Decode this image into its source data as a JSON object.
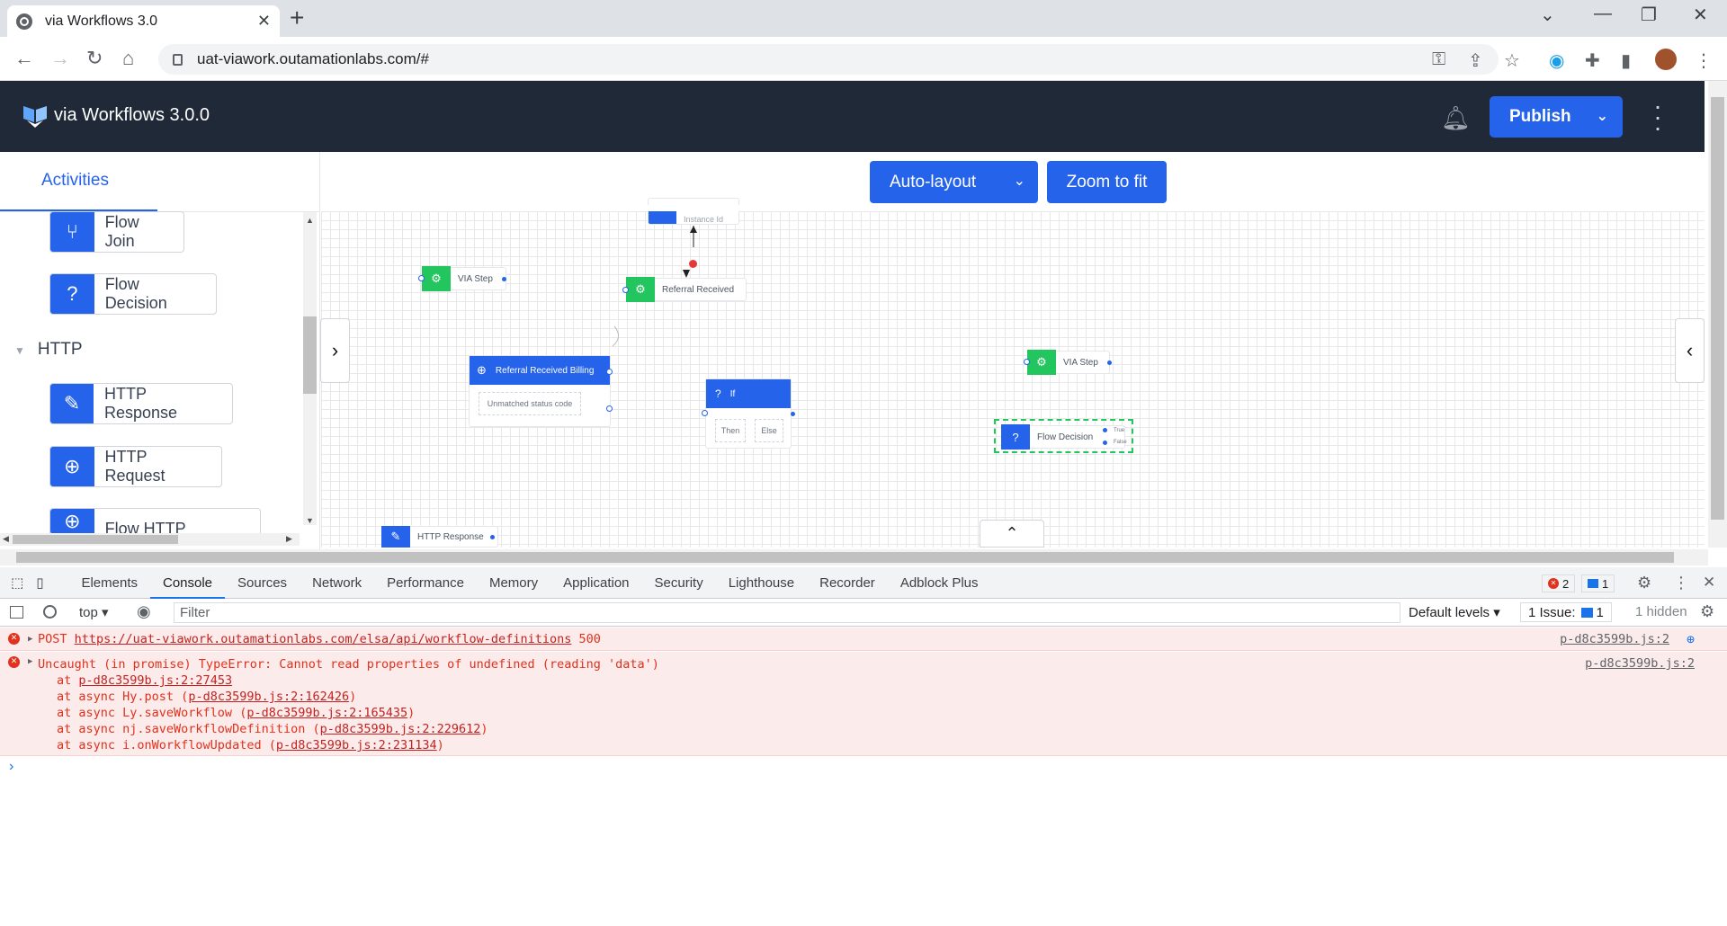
{
  "browser": {
    "tab_title": "via Workflows 3.0",
    "tab_close": "✕",
    "new_tab": "+",
    "url": "uat-viawork.outamationlabs.com/#"
  },
  "app": {
    "title": "via Workflows 3.0.0",
    "publish_label": "Publish"
  },
  "sidebar": {
    "tab_label": "Activities",
    "items_top": [
      {
        "label": "Flow Join",
        "icon": "flow-join-icon"
      },
      {
        "label": "Flow Decision",
        "icon": "question-icon"
      }
    ],
    "category": "HTTP",
    "items_http": [
      {
        "label": "HTTP Response",
        "icon": "edit-icon"
      },
      {
        "label": "HTTP Request",
        "icon": "globe-icon"
      },
      {
        "label": "Flow HTTP Request",
        "icon": "globe-icon"
      }
    ]
  },
  "canvas": {
    "auto_layout_label": "Auto-layout",
    "zoom_fit_label": "Zoom to fit",
    "nodes": {
      "instance_id": "Instance Id",
      "via_step_1": "VIA Step",
      "referral_received": "Referral Received",
      "referral_received_billing": "Referral Received Billing",
      "unmatched_status": "Unmatched status code",
      "if": "If",
      "then": "Then",
      "else": "Else",
      "via_step_2": "VIA Step",
      "flow_decision": "Flow Decision",
      "true": "True",
      "false": "False",
      "http_response": "HTTP Response"
    }
  },
  "devtools": {
    "tabs": [
      "Elements",
      "Console",
      "Sources",
      "Network",
      "Performance",
      "Memory",
      "Application",
      "Security",
      "Lighthouse",
      "Recorder",
      "Adblock Plus"
    ],
    "active_tab": "Console",
    "error_count": "2",
    "message_count": "1",
    "context": "top",
    "filter_placeholder": "Filter",
    "levels": "Default levels",
    "issues": "1 Issue:",
    "issue_count": "1",
    "hidden": "1 hidden",
    "errors": [
      {
        "prefix": "POST",
        "url": "https://uat-viawork.outamationlabs.com/elsa/api/workflow-definitions",
        "status": "500",
        "source": "p-d8c3599b.js:2"
      },
      {
        "message": "Uncaught (in promise) TypeError: Cannot read properties of undefined (reading 'data')",
        "source": "p-d8c3599b.js:2",
        "stack": [
          {
            "pre": "at ",
            "link": "p-d8c3599b.js:2:27453",
            "post": ""
          },
          {
            "pre": "at async Hy.post (",
            "link": "p-d8c3599b.js:2:162426",
            "post": ")"
          },
          {
            "pre": "at async Ly.saveWorkflow (",
            "link": "p-d8c3599b.js:2:165435",
            "post": ")"
          },
          {
            "pre": "at async nj.saveWorkflowDefinition (",
            "link": "p-d8c3599b.js:2:229612",
            "post": ")"
          },
          {
            "pre": "at async i.onWorkflowUpdated (",
            "link": "p-d8c3599b.js:2:231134",
            "post": ")"
          }
        ]
      }
    ],
    "prompt": "›"
  },
  "colors": {
    "header_bg": "#1f2937",
    "primary": "#2563eb",
    "node_green": "#22c55e",
    "error_red": "#e2311c"
  }
}
